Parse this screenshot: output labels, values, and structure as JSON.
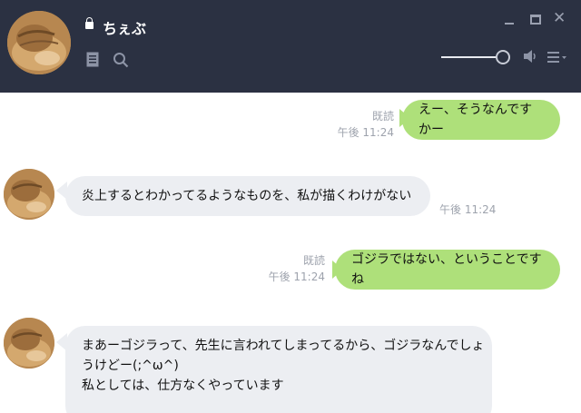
{
  "header": {
    "contact_name": "ちぇぶ",
    "icons": [
      "lock-icon",
      "note-icon",
      "search-icon",
      "minimize-icon",
      "maximize-icon",
      "close-icon",
      "speaker-icon",
      "menu-icon"
    ],
    "volume": 0.92,
    "close_glyph": "✕"
  },
  "messages": [
    {
      "from": "me",
      "text": "えー、そうなんですかー",
      "read": "既読",
      "time": "午後 11:24"
    },
    {
      "from": "other",
      "text": "炎上するとわかってるようなものを、私が描くわけがない",
      "time": "午後 11:24"
    },
    {
      "from": "me",
      "text": "ゴジラではない、ということですね",
      "read": "既読",
      "time": "午後 11:24"
    },
    {
      "from": "other",
      "lines": [
        "まあーゴジラって、先生に言われてしまってるから、ゴジラなんでしょ",
        "うけどー(;^ω^)",
        "私としては、仕方なくやっています"
      ]
    }
  ],
  "colors": {
    "header_bg": "#2b3142",
    "my_bubble": "#aee07a",
    "other_bubble": "#eceef2",
    "meta_text": "#9ea3ad"
  }
}
